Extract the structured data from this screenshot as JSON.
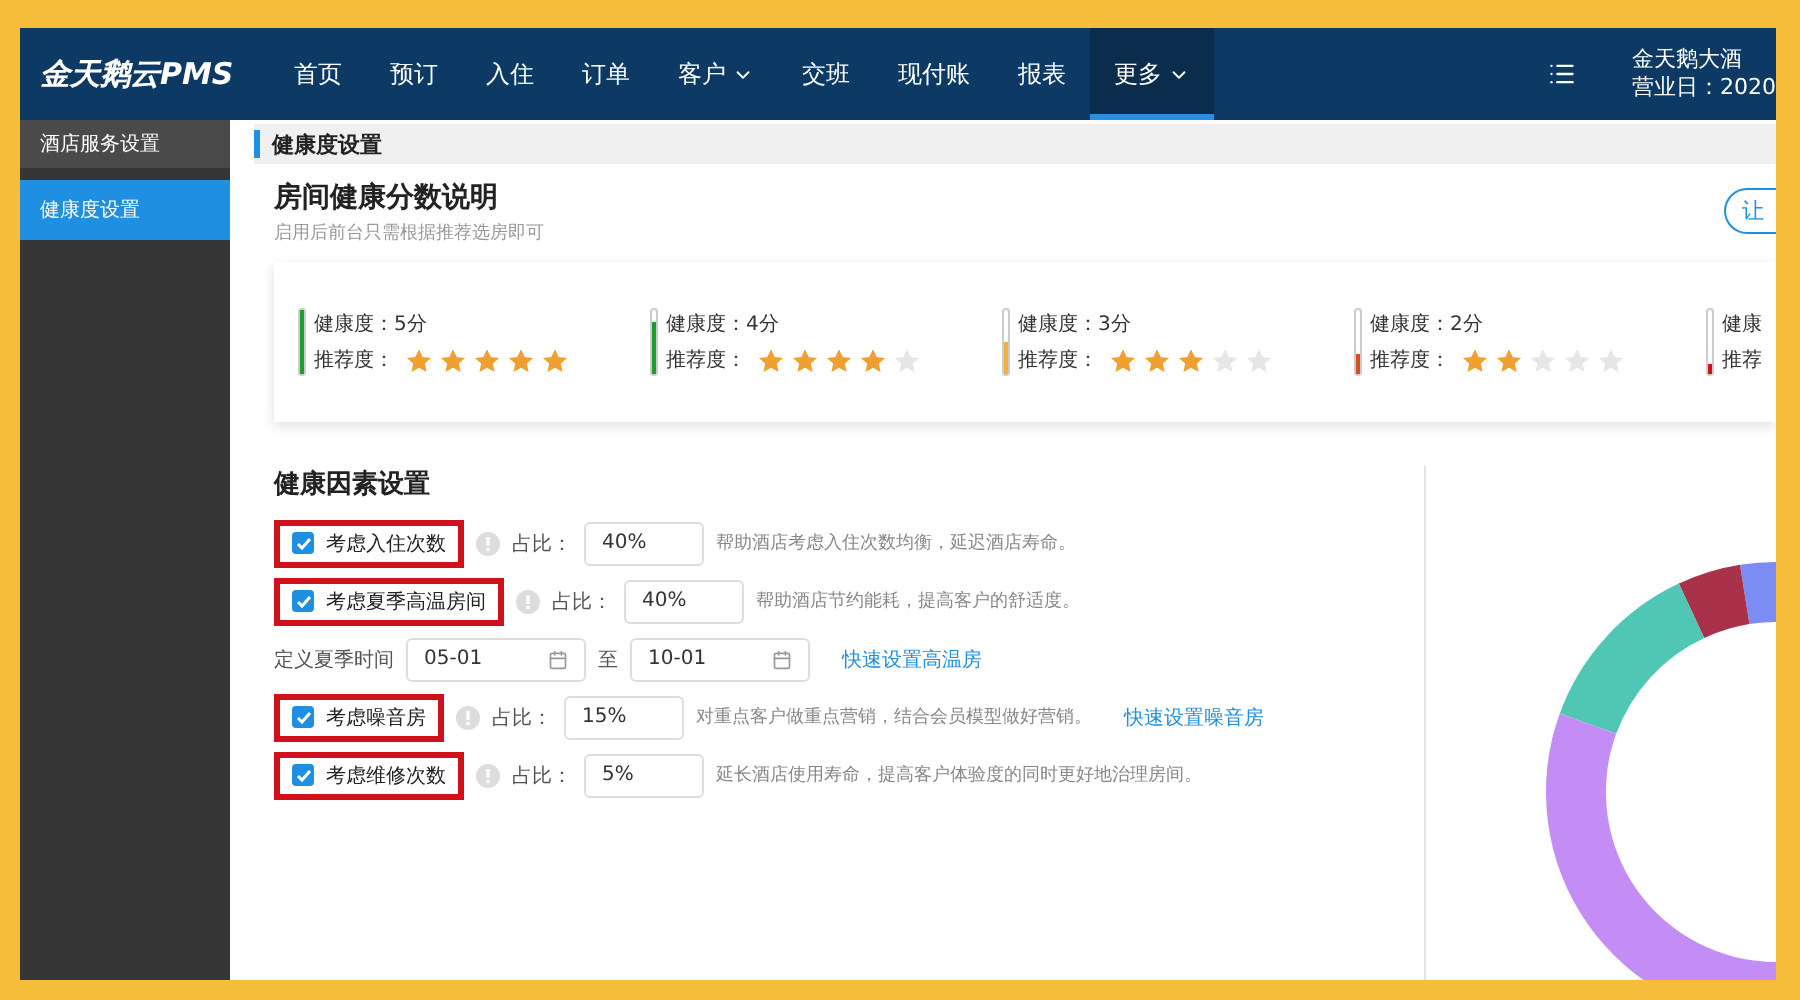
{
  "header": {
    "logo": "金天鹅云PMS",
    "nav": [
      {
        "label": "首页",
        "selected": false,
        "dropdown": false
      },
      {
        "label": "预订",
        "selected": false,
        "dropdown": false
      },
      {
        "label": "入住",
        "selected": false,
        "dropdown": false
      },
      {
        "label": "订单",
        "selected": false,
        "dropdown": false
      },
      {
        "label": "客户",
        "selected": false,
        "dropdown": true
      },
      {
        "label": "交班",
        "selected": false,
        "dropdown": false
      },
      {
        "label": "现付账",
        "selected": false,
        "dropdown": false
      },
      {
        "label": "报表",
        "selected": false,
        "dropdown": false
      },
      {
        "label": "更多",
        "selected": true,
        "dropdown": true
      }
    ],
    "hotel": "金天鹅大酒",
    "business_day": "营业日：2020"
  },
  "sidebar": {
    "items": [
      {
        "label": "酒店服务设置",
        "selected": false
      },
      {
        "label": "健康度设置",
        "selected": true
      }
    ]
  },
  "section_title": "健康度设置",
  "explanation": {
    "title": "房间健康分数说明",
    "subtitle": "启用后前台只需根据推荐选房即可",
    "button": "让",
    "levels": [
      {
        "health": "健康度：5分",
        "recommend": "推荐度：",
        "stars": 5,
        "level": 1,
        "color": "#1a9e2c"
      },
      {
        "health": "健康度：4分",
        "recommend": "推荐度：",
        "stars": 4,
        "level": 0.8,
        "color": "#1a9e2c"
      },
      {
        "health": "健康度：3分",
        "recommend": "推荐度：",
        "stars": 3,
        "level": 0.5,
        "color": "#f0b03c"
      },
      {
        "health": "健康度：2分",
        "recommend": "推荐度：",
        "stars": 2,
        "level": 0.3,
        "color": "#d2501e"
      },
      {
        "health": "健康",
        "recommend": "推荐",
        "level": 0.15,
        "color": "#d0101a"
      }
    ]
  },
  "factors": {
    "title": "健康因素设置",
    "items": [
      {
        "label": "考虑入住次数",
        "checked": true,
        "highlighted": true,
        "ratio_label": "占比：",
        "ratio": "40%",
        "description": "帮助酒店考虑入住次数均衡，延迟酒店寿命。"
      },
      {
        "label": "考虑夏季高温房间",
        "checked": true,
        "highlighted": true,
        "ratio_label": "占比：",
        "ratio": "40%",
        "description": "帮助酒店节约能耗，提高客户的舒适度。",
        "season": {
          "label": "定义夏季时间",
          "start": "05-01",
          "to": "至",
          "end": "10-01",
          "link": "快速设置高温房"
        }
      },
      {
        "label": "考虑噪音房",
        "checked": true,
        "highlighted": true,
        "ratio_label": "占比：",
        "ratio": "15%",
        "description": "对重点客户做重点营销，结合会员模型做好营销。",
        "link": "快速设置噪音房"
      },
      {
        "label": "考虑维修次数",
        "checked": true,
        "highlighted": true,
        "ratio_label": "占比：",
        "ratio": "5%",
        "description": "延长酒店使用寿命，提高客户体验度的同时更好地治理房间。"
      }
    ]
  }
}
